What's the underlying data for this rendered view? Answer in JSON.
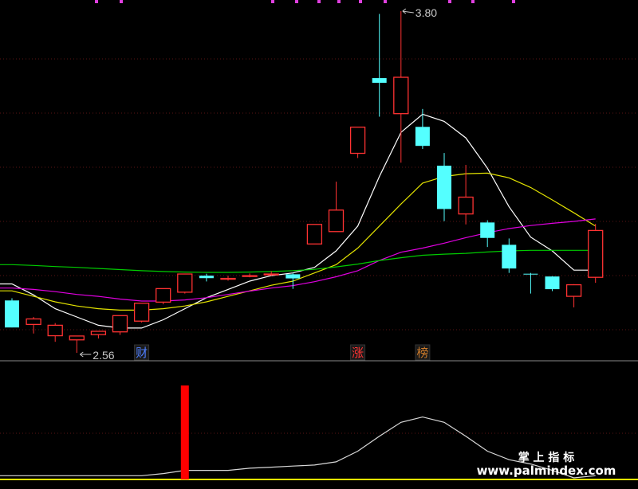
{
  "chart_data": {
    "type": "candlestick",
    "price_range": [
      2.4,
      3.85
    ],
    "candles": [
      {
        "o": 2.75,
        "h": 2.758,
        "l": 2.652,
        "c": 2.652
      },
      {
        "o": 2.663,
        "h": 2.69,
        "l": 2.63,
        "c": 2.683
      },
      {
        "o": 2.622,
        "h": 2.668,
        "l": 2.6,
        "c": 2.66
      },
      {
        "o": 2.607,
        "h": 2.62,
        "l": 2.56,
        "c": 2.621
      },
      {
        "o": 2.626,
        "h": 2.638,
        "l": 2.612,
        "c": 2.638
      },
      {
        "o": 2.636,
        "h": 2.695,
        "l": 2.625,
        "c": 2.695
      },
      {
        "o": 2.675,
        "h": 2.74,
        "l": 2.67,
        "c": 2.74
      },
      {
        "o": 2.744,
        "h": 2.793,
        "l": 2.736,
        "c": 2.793
      },
      {
        "o": 2.78,
        "h": 2.846,
        "l": 2.775,
        "c": 2.846
      },
      {
        "o": 2.84,
        "h": 2.847,
        "l": 2.819,
        "c": 2.831
      },
      {
        "o": 2.83,
        "h": 2.84,
        "l": 2.822,
        "c": 2.83
      },
      {
        "o": 2.84,
        "h": 2.848,
        "l": 2.834,
        "c": 2.84
      },
      {
        "o": 2.845,
        "h": 2.856,
        "l": 2.839,
        "c": 2.846
      },
      {
        "o": 2.845,
        "h": 2.85,
        "l": 2.792,
        "c": 2.83
      },
      {
        "o": 2.955,
        "h": 3.026,
        "l": 2.955,
        "c": 3.026
      },
      {
        "o": 3.0,
        "h": 3.181,
        "l": 3.0,
        "c": 3.078
      },
      {
        "o": 3.284,
        "h": 3.379,
        "l": 3.267,
        "c": 3.379
      },
      {
        "o": 3.557,
        "h": 3.79,
        "l": 3.417,
        "c": 3.54
      },
      {
        "o": 3.428,
        "h": 3.8,
        "l": 3.25,
        "c": 3.56
      },
      {
        "o": 3.38,
        "h": 3.445,
        "l": 3.3,
        "c": 3.311
      },
      {
        "o": 3.239,
        "h": 3.285,
        "l": 3.038,
        "c": 3.082
      },
      {
        "o": 3.064,
        "h": 3.242,
        "l": 3.026,
        "c": 3.125
      },
      {
        "o": 3.033,
        "h": 3.041,
        "l": 2.944,
        "c": 2.977
      },
      {
        "o": 2.952,
        "h": 2.975,
        "l": 2.85,
        "c": 2.866
      },
      {
        "o": 2.847,
        "h": 2.85,
        "l": 2.775,
        "c": 2.845
      },
      {
        "o": 2.837,
        "h": 2.838,
        "l": 2.784,
        "c": 2.791
      },
      {
        "o": 2.765,
        "h": 2.809,
        "l": 2.725,
        "c": 2.807
      },
      {
        "o": 2.834,
        "h": 3.028,
        "l": 2.814,
        "c": 3.004
      }
    ],
    "lines": [
      {
        "color": "#ffffff",
        "values": [
          2.81,
          2.77,
          2.72,
          2.69,
          2.66,
          2.65,
          2.65,
          2.68,
          2.72,
          2.76,
          2.79,
          2.82,
          2.84,
          2.85,
          2.87,
          2.93,
          3.02,
          3.2,
          3.36,
          3.426,
          3.4,
          3.34,
          3.23,
          3.09,
          2.98,
          2.93,
          2.86,
          2.86
        ]
      },
      {
        "color": "#e3e300",
        "values": [
          2.785,
          2.765,
          2.745,
          2.73,
          2.72,
          2.715,
          2.715,
          2.72,
          2.73,
          2.745,
          2.765,
          2.785,
          2.805,
          2.82,
          2.85,
          2.88,
          2.94,
          3.02,
          3.1,
          3.176,
          3.2,
          3.21,
          3.212,
          3.195,
          3.16,
          3.115,
          3.068,
          3.02
        ]
      },
      {
        "color": "#e000e0",
        "values": [
          2.795,
          2.79,
          2.782,
          2.772,
          2.765,
          2.755,
          2.748,
          2.748,
          2.752,
          2.76,
          2.772,
          2.784,
          2.795,
          2.804,
          2.818,
          2.836,
          2.858,
          2.895,
          2.925,
          2.94,
          2.958,
          2.978,
          2.996,
          3.011,
          3.022,
          3.03,
          3.037,
          3.046
        ]
      },
      {
        "color": "#00cc00",
        "values": [
          2.88,
          2.877,
          2.873,
          2.87,
          2.866,
          2.862,
          2.858,
          2.855,
          2.853,
          2.852,
          2.852,
          2.853,
          2.855,
          2.858,
          2.863,
          2.872,
          2.882,
          2.895,
          2.905,
          2.914,
          2.918,
          2.921,
          2.926,
          2.93,
          2.932,
          2.932,
          2.932,
          2.932
        ]
      }
    ],
    "annotations": {
      "high_label": "3.80",
      "low_label": "2.56"
    },
    "event_badges": [
      {
        "candle": 6,
        "text": "财",
        "color": "#4f7fff"
      },
      {
        "candle": 16,
        "text": "涨",
        "color": "#ff3333"
      },
      {
        "candle": 19,
        "text": "榜",
        "color": "#cc7a2a"
      }
    ],
    "indicator": {
      "spike_candle": 8,
      "line_values": [
        0.05,
        0.05,
        0.05,
        0.05,
        0.05,
        0.05,
        0.05,
        0.07,
        0.1,
        0.1,
        0.1,
        0.12,
        0.13,
        0.14,
        0.15,
        0.18,
        0.28,
        0.42,
        0.55,
        0.6,
        0.55,
        0.42,
        0.28,
        0.2,
        0.16,
        0.1,
        0.03,
        0.05
      ]
    }
  },
  "watermark": {
    "line1": "掌 上 指 标",
    "line2": "www.palmindex.com"
  }
}
